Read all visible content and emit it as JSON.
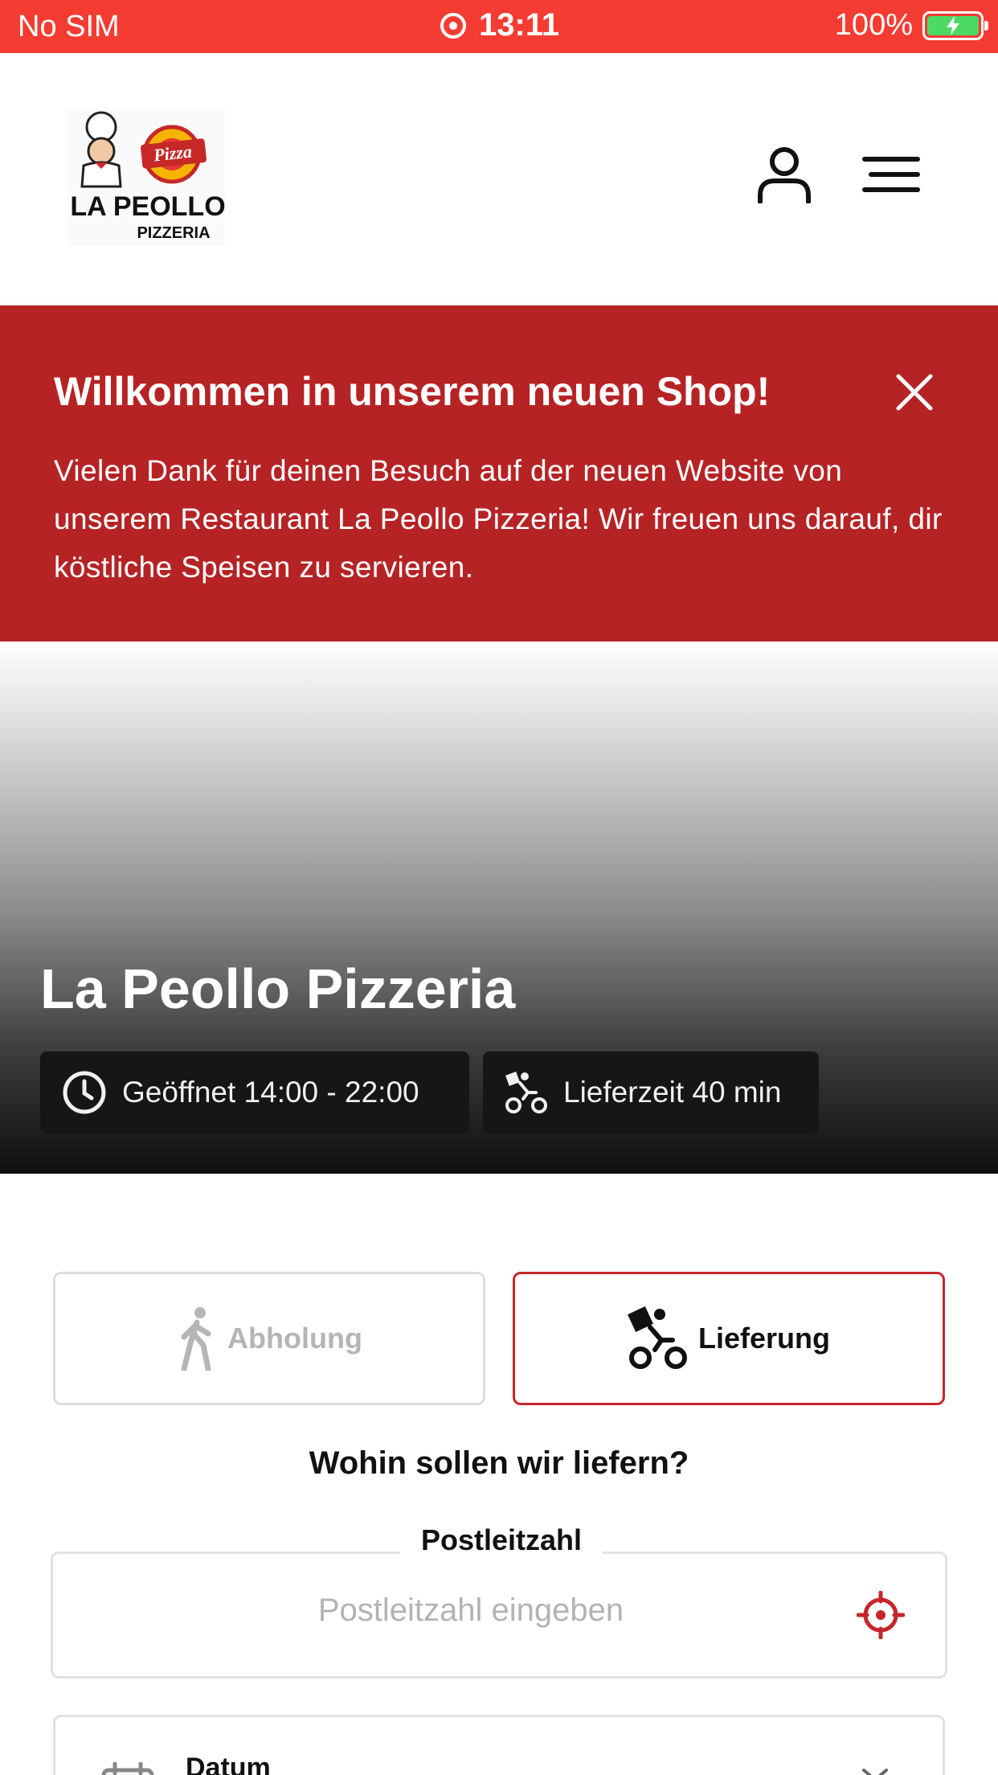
{
  "status_bar": {
    "carrier": "No SIM",
    "time": "13:11",
    "battery": "100%",
    "battery_level": 1.0
  },
  "header": {
    "logo_text": [
      "Pizza",
      "LA PEOLLO",
      "PIZZERIA"
    ],
    "icons": [
      "user-icon",
      "hamburger-menu-icon"
    ]
  },
  "banner": {
    "title": "Willkommen in unserem neuen Shop!",
    "text": "Vielen Dank für deinen Besuch auf der neuen Website von unserem Restaurant La Peollo Pizzeria! Wir freuen uns darauf, dir köstliche Speisen zu servieren.",
    "icon": "close-icon"
  },
  "hero": {
    "title": "La Peollo Pizzeria",
    "hours": "Geöffnet 14:00 - 22:00",
    "delivery_time": "Lieferzeit 40 min"
  },
  "order_mode": {
    "pickup_label": "Abholung",
    "delivery_label": "Lieferung",
    "selected": "Lieferung"
  },
  "delivery_form": {
    "question": "Wohin sollen wir liefern?",
    "postal_label": "Postleitzahl",
    "postal_placeholder": "Postleitzahl eingeben",
    "postal_value": "",
    "date_label": "Datum"
  },
  "colors": {
    "status_bar": "#f43c32",
    "banner": "#b62325",
    "accent": "#c6262a",
    "chip": "#161616"
  }
}
